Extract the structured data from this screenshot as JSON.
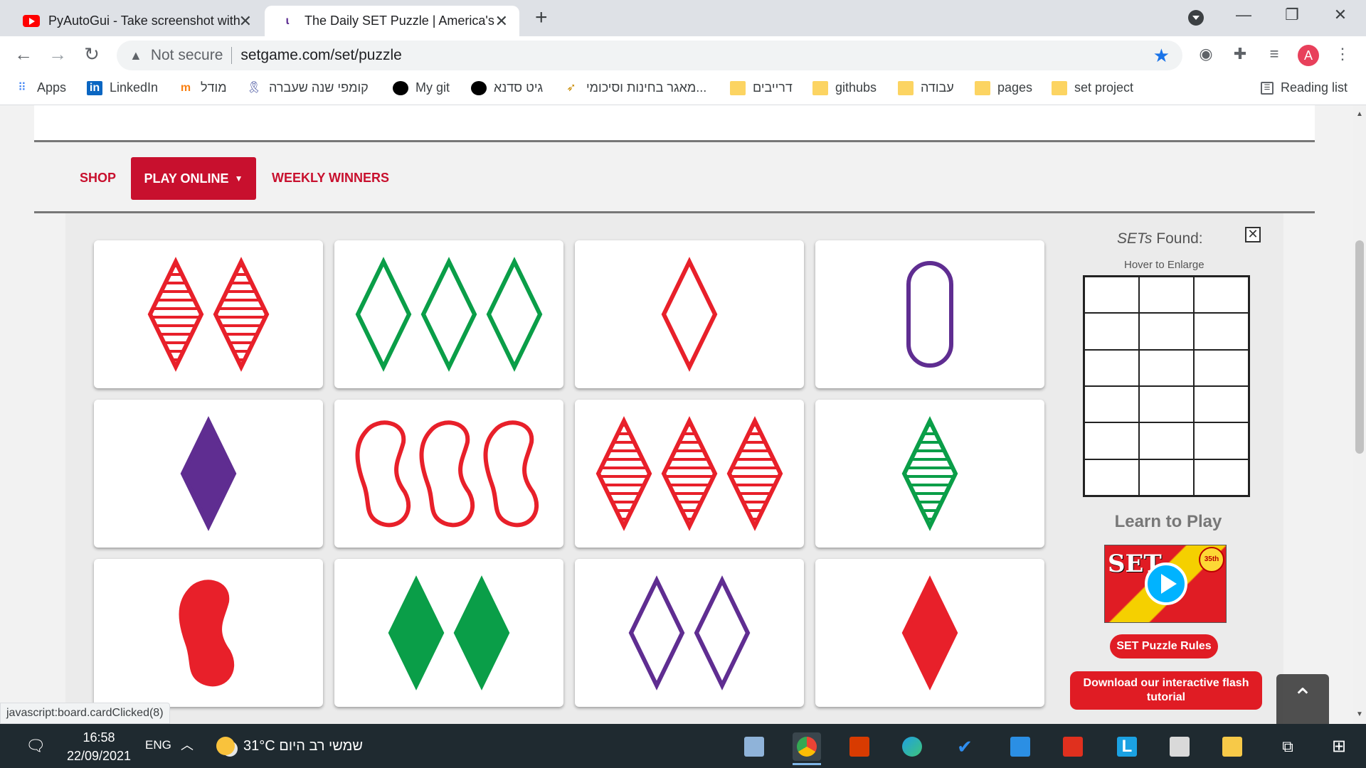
{
  "browser": {
    "tabs": [
      {
        "title": "PyAutoGui - Take screenshot with",
        "active": false,
        "icon": "youtube-icon"
      },
      {
        "title": "The Daily SET Puzzle | America's F",
        "active": true,
        "icon": "set-favicon"
      }
    ],
    "address": {
      "security": "Not secure",
      "url": "setgame.com/set/puzzle"
    },
    "bookmarks": [
      {
        "label": "Apps",
        "icon": "apps-grid-icon"
      },
      {
        "label": "LinkedIn",
        "icon": "linkedin-icon"
      },
      {
        "label": "מודל",
        "icon": "moodle-icon"
      },
      {
        "label": "קומפי שנה שעברה",
        "icon": "ribbon-icon"
      },
      {
        "label": "My git",
        "icon": "github-icon"
      },
      {
        "label": "גיט סדנא",
        "icon": "github-icon"
      },
      {
        "label": "מאגר בחינות וסיכומי...",
        "icon": "bird-icon"
      },
      {
        "label": "דרייבים",
        "icon": "folder-icon"
      },
      {
        "label": "githubs",
        "icon": "folder-icon"
      },
      {
        "label": "עבודה",
        "icon": "folder-icon"
      },
      {
        "label": "pages",
        "icon": "folder-icon"
      },
      {
        "label": "set project",
        "icon": "folder-icon"
      }
    ],
    "reading_list": "Reading list",
    "profile_initial": "A",
    "status_url": "javascript:board.cardClicked(8)"
  },
  "site": {
    "nav": {
      "shop": "SHOP",
      "play_online": "PLAY ONLINE",
      "weekly_winners": "WEEKLY WINNERS"
    },
    "cards": [
      {
        "number": 2,
        "color": "red",
        "shape": "diamond",
        "shading": "striped"
      },
      {
        "number": 3,
        "color": "green",
        "shape": "diamond",
        "shading": "open"
      },
      {
        "number": 1,
        "color": "red",
        "shape": "diamond",
        "shading": "open"
      },
      {
        "number": 1,
        "color": "purple",
        "shape": "oval",
        "shading": "open"
      },
      {
        "number": 1,
        "color": "purple",
        "shape": "diamond",
        "shading": "solid"
      },
      {
        "number": 3,
        "color": "red",
        "shape": "squiggle",
        "shading": "open"
      },
      {
        "number": 3,
        "color": "red",
        "shape": "diamond",
        "shading": "striped"
      },
      {
        "number": 1,
        "color": "green",
        "shape": "diamond",
        "shading": "striped"
      },
      {
        "number": 1,
        "color": "red",
        "shape": "squiggle",
        "shading": "solid"
      },
      {
        "number": 2,
        "color": "green",
        "shape": "diamond",
        "shading": "solid"
      },
      {
        "number": 2,
        "color": "purple",
        "shape": "diamond",
        "shading": "open"
      },
      {
        "number": 1,
        "color": "red",
        "shape": "diamond",
        "shading": "solid"
      }
    ],
    "colors": {
      "red": "#e8202a",
      "green": "#0a9e48",
      "purple": "#5f2d91",
      "brand": "#c8102e"
    },
    "sidebar": {
      "sets_found_italic": "SETs",
      "sets_found_rest": " Found:",
      "close": "✕",
      "hover_hint": "Hover to Enlarge",
      "learn": "Learn to Play",
      "video_text": "SET",
      "video_badge": "35th",
      "rules_button": "SET Puzzle Rules",
      "flash_button": "Download our interactive flash tutorial"
    }
  },
  "taskbar": {
    "time": "16:58",
    "date": "22/09/2021",
    "lang": "ENG",
    "weather": "31°C שמשי רב היום"
  }
}
